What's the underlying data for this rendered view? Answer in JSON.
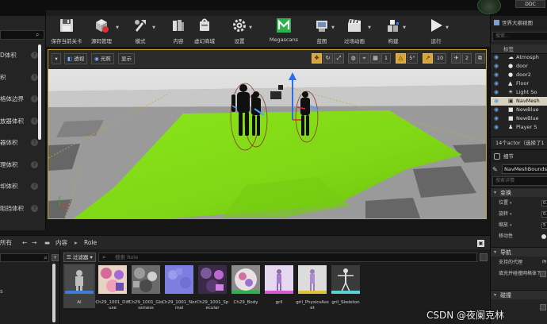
{
  "window": {
    "badge": "DDC"
  },
  "left_panel": {
    "items": [
      {
        "label": "D体积"
      },
      {
        "label": "积"
      },
      {
        "label": "格体边界"
      },
      {
        "label": "放器体积"
      },
      {
        "label": "器体积"
      },
      {
        "label": "理体积"
      },
      {
        "label": "却体积"
      },
      {
        "label": "阻挡体积"
      }
    ],
    "help_glyph": "?"
  },
  "toolbar": {
    "buttons": [
      {
        "label": "保存当前关卡",
        "icon": "save-icon"
      },
      {
        "label": "源码管理",
        "icon": "source-control-icon"
      },
      {
        "label": "模式",
        "icon": "modes-icon"
      },
      {
        "label": "内容",
        "icon": "content-icon"
      },
      {
        "label": "虚幻商城",
        "icon": "marketplace-icon"
      },
      {
        "label": "设置",
        "icon": "settings-icon"
      },
      {
        "label": "Megascans",
        "icon": "megascans-icon"
      },
      {
        "label": "蓝图",
        "icon": "blueprint-icon"
      },
      {
        "label": "过场动画",
        "icon": "cinematics-icon"
      },
      {
        "label": "构建",
        "icon": "build-icon"
      },
      {
        "label": "运行",
        "icon": "play-icon"
      }
    ],
    "more": "»"
  },
  "viewport": {
    "menu_glyph": "▾",
    "perspective": "透视",
    "lit": "光照",
    "show": "显示",
    "grid_snap": "1",
    "angle_snap": "5°",
    "scale_snap": "10",
    "camera_speed": "2"
  },
  "outliner": {
    "title": "世界大纲视图",
    "search_placeholder": "搜索...",
    "col_label": "标签",
    "rows": [
      {
        "label": "Atmosph",
        "glyph": "☁"
      },
      {
        "label": "door",
        "glyph": "●"
      },
      {
        "label": "door2",
        "glyph": "●"
      },
      {
        "label": "Floor",
        "glyph": "▲"
      },
      {
        "label": "Light So",
        "glyph": "☀"
      },
      {
        "label": "NavMesh",
        "glyph": "▣",
        "selected": true
      },
      {
        "label": "NewBlue",
        "glyph": "■"
      },
      {
        "label": "NewBlue",
        "glyph": "■"
      },
      {
        "label": "Player S",
        "glyph": "♟"
      }
    ],
    "footer": "14个actor（选择了1"
  },
  "details": {
    "title": "细节",
    "name": "NavMeshBounds",
    "search_placeholder": "搜索详情",
    "sections": {
      "transform": "变换",
      "navigation": "导航",
      "collision": "碰撞"
    },
    "rows": {
      "location": "位置",
      "rotation": "旋转",
      "scale": "缩放",
      "mobility": "移动性",
      "supported_agents": "支持的代理",
      "fill_collision": "填充并碰撞网格体下"
    },
    "values": {
      "location": "0.",
      "rotation": "0.",
      "scale": "5",
      "supported_agents": "所"
    },
    "dropdown_glyph": "▾"
  },
  "content_browser": {
    "left_label": "所有",
    "left_text": "s",
    "nav": [
      "←",
      "→"
    ],
    "path": [
      "内容",
      "Role"
    ],
    "filter_label": "过滤器",
    "search_placeholder": "搜索 Role",
    "assets": [
      {
        "name": "AI",
        "selected": true
      },
      {
        "name": "Ch29_1001_Diffuse"
      },
      {
        "name": "Ch29_1001_Glossiness"
      },
      {
        "name": "Ch29_1001_Normal"
      },
      {
        "name": "Ch29_1001_Specular"
      },
      {
        "name": "Ch29_Body"
      },
      {
        "name": "gril"
      },
      {
        "name": "gril_PhysicsAsset"
      },
      {
        "name": "gril_Skeleton"
      }
    ]
  },
  "watermark": "CSDN @夜阑克林",
  "colors": {
    "accent_selection": "#c7a433",
    "floor_green": "#86e31a",
    "panel_bg": "#242424"
  }
}
